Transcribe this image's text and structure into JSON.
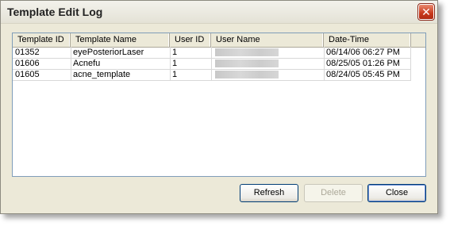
{
  "window": {
    "title": "Template Edit Log",
    "close_glyph": "✕"
  },
  "table": {
    "columns": [
      "Template ID",
      "Template Name",
      "User ID",
      "User Name",
      "Date-Time"
    ],
    "rows": [
      {
        "template_id": "01352",
        "template_name": "eyePosteriorLaser",
        "user_id": "1",
        "user_name_redacted": true,
        "date_time": "06/14/06 06:27 PM"
      },
      {
        "template_id": "01606",
        "template_name": "Acnefu",
        "user_id": "1",
        "user_name_redacted": true,
        "date_time": "08/25/05 01:26 PM"
      },
      {
        "template_id": "01605",
        "template_name": "acne_template",
        "user_id": "1",
        "user_name_redacted": true,
        "date_time": "08/24/05 05:45 PM"
      }
    ]
  },
  "buttons": {
    "refresh": "Refresh",
    "delete": "Delete",
    "close": "Close"
  },
  "colors": {
    "dialog_bg": "#ece9d8",
    "close_button": "#c8391c",
    "button_border": "#003c74"
  }
}
